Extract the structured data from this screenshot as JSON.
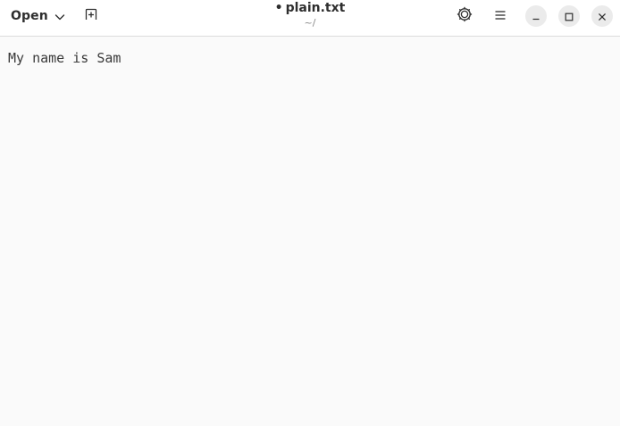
{
  "header": {
    "open_label": "Open",
    "modified_indicator": "•",
    "file_name": "plain.txt",
    "file_path": "~/",
    "icons": {
      "open_dropdown": "chevron-down-icon",
      "new_tab": "new-tab-icon",
      "settings": "gear-icon",
      "menu": "hamburger-menu-icon",
      "minimize": "minimize-icon",
      "maximize": "maximize-icon",
      "close": "close-icon"
    }
  },
  "editor": {
    "content": "My name is Sam"
  },
  "colors": {
    "header_bg": "#ffffff",
    "editor_bg": "#fafafa",
    "text": "#2e2e2e",
    "window_button_bg": "#ebebeb"
  }
}
